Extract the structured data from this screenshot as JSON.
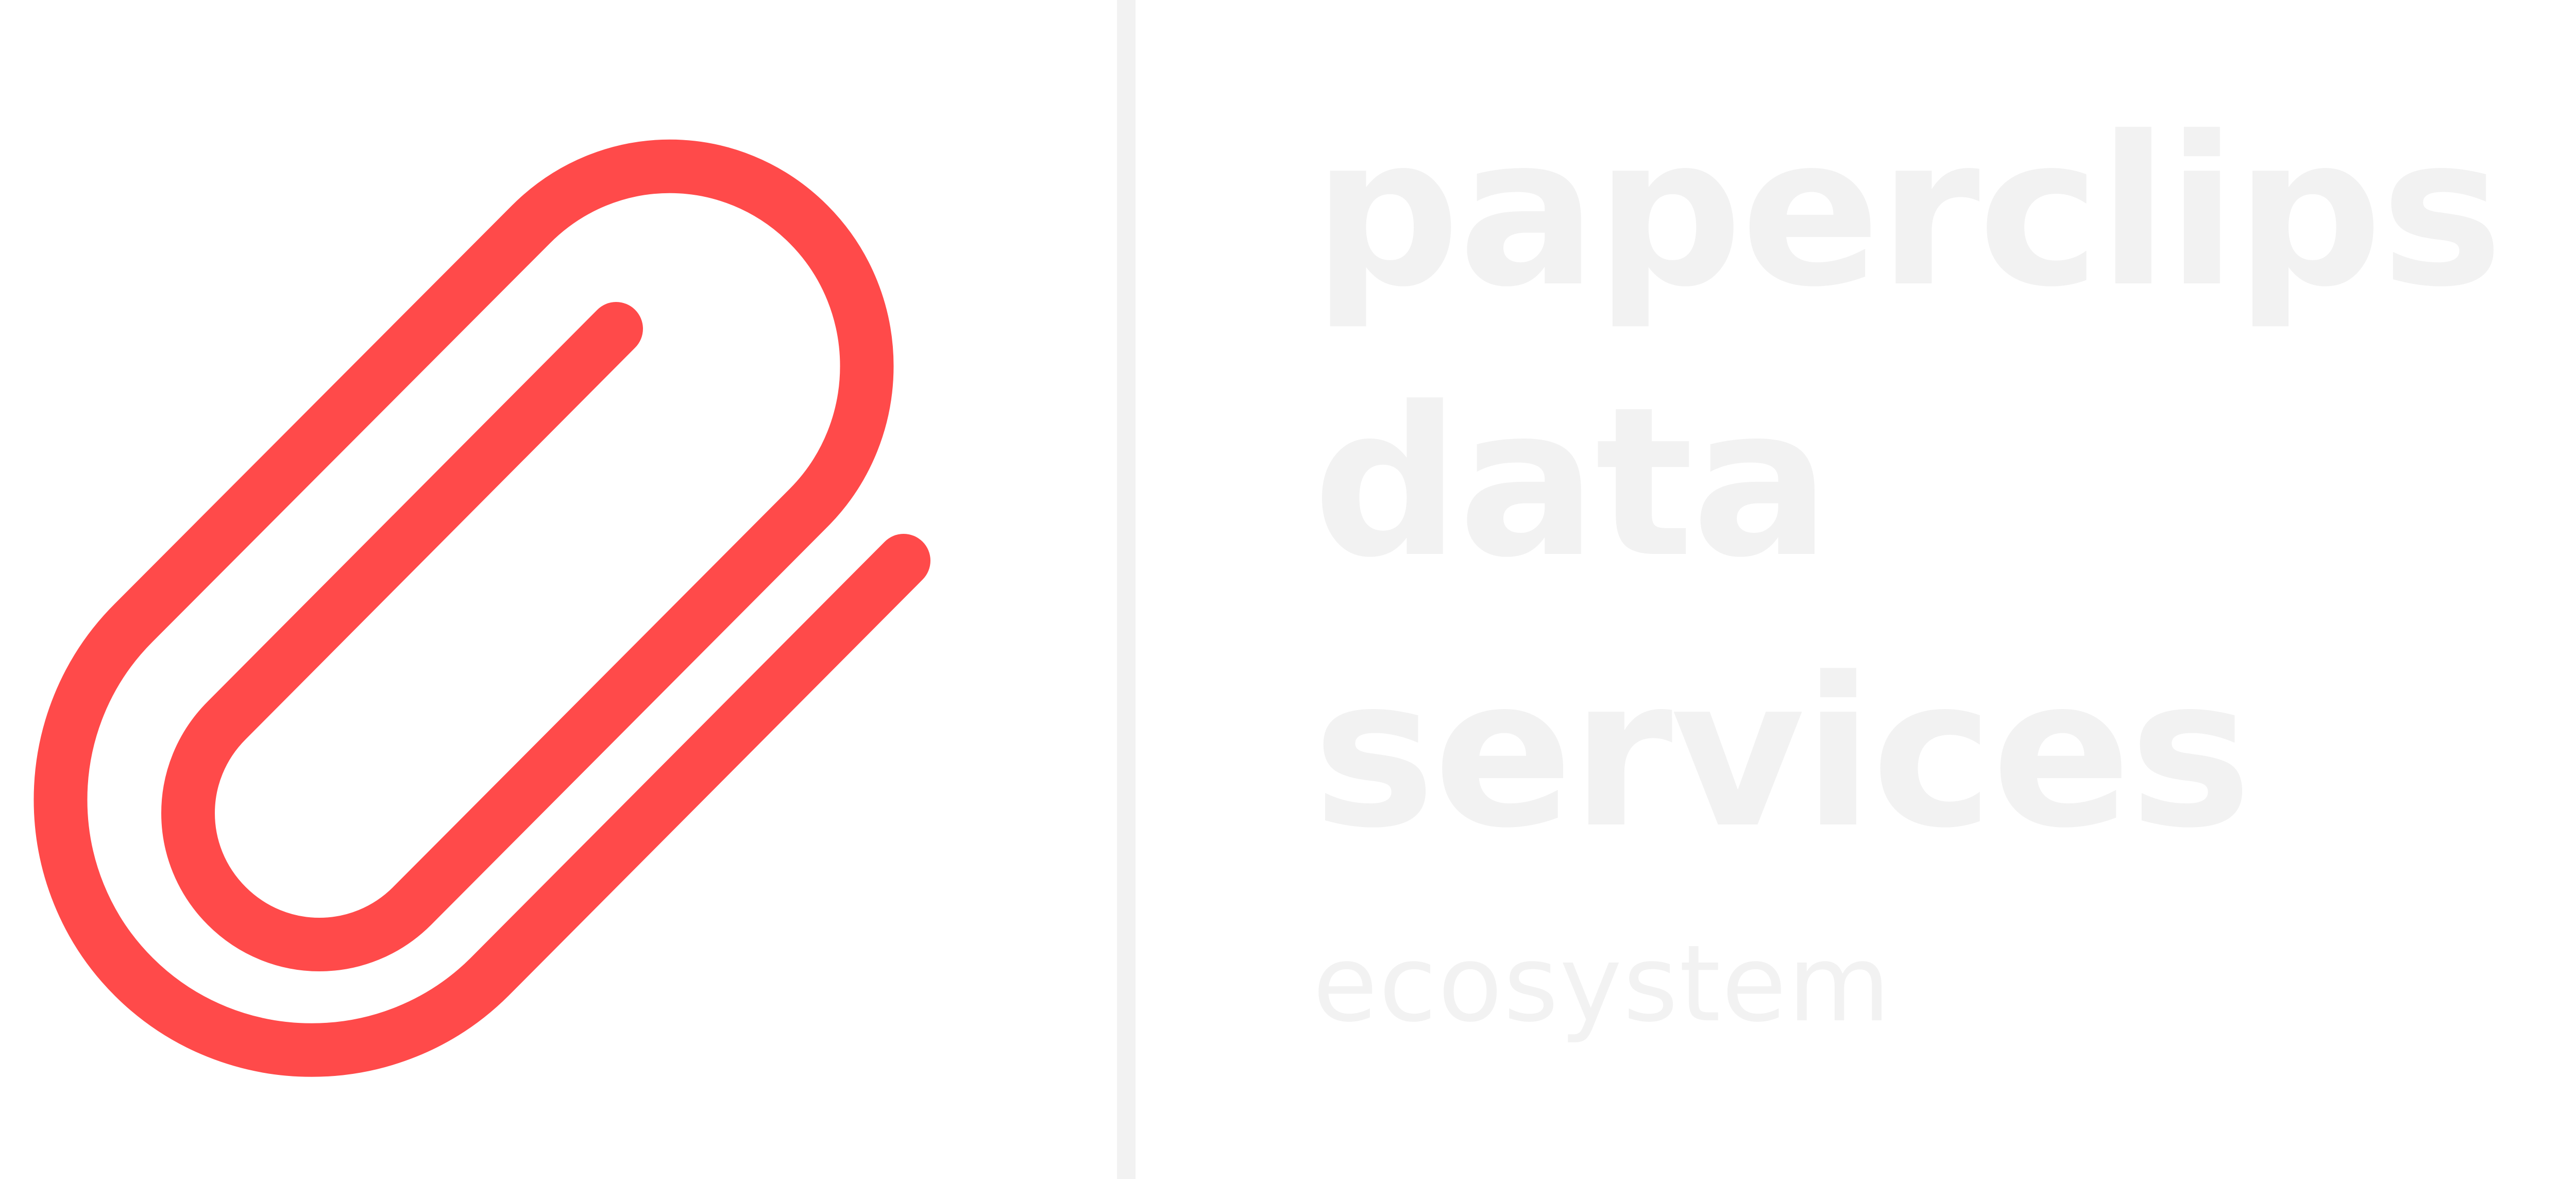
{
  "brand": {
    "wordmark_lines": [
      "paperclips",
      "data",
      "services"
    ],
    "tagline": "ecosystem",
    "icon": "paperclip-icon",
    "colors": {
      "accent": "#ff4a4a",
      "wordmark": "#f2f2f2",
      "divider": "#f2f2f2",
      "background": "#ffffff"
    }
  }
}
